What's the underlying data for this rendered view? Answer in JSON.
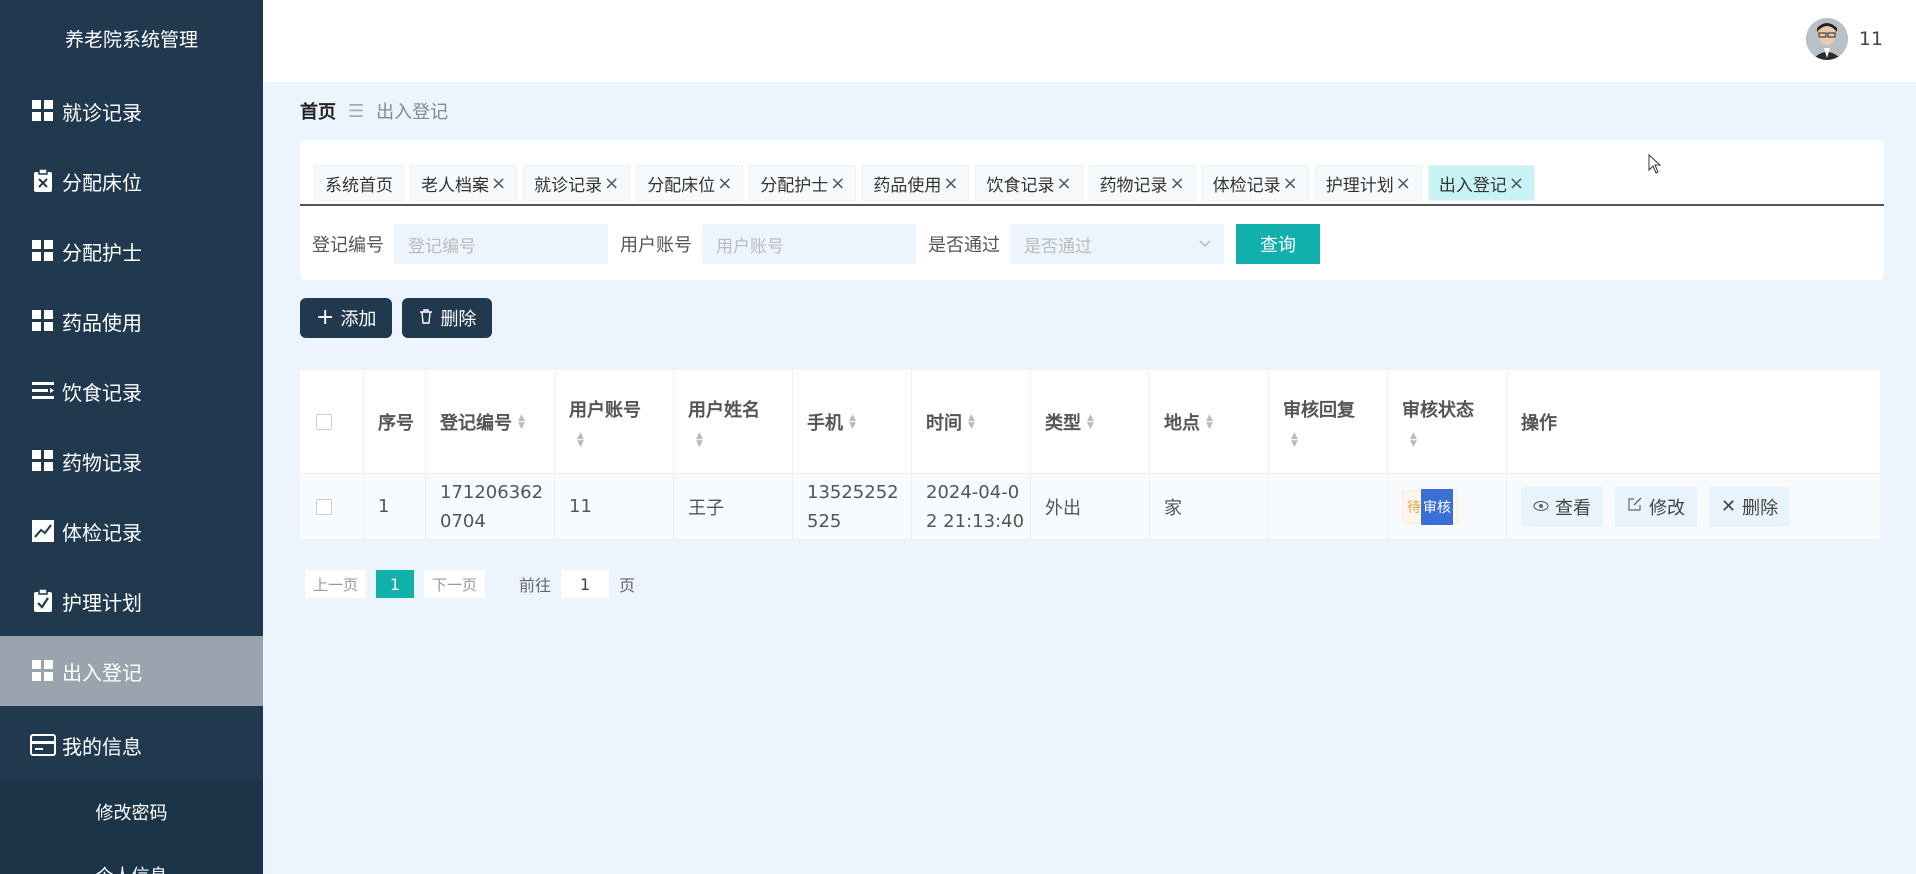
{
  "sidebar": {
    "brand": "养老院系统管理",
    "items": [
      {
        "label": "就诊记录",
        "icon": "grid-icon"
      },
      {
        "label": "分配床位",
        "icon": "clipboard-x-icon"
      },
      {
        "label": "分配护士",
        "icon": "grid-icon"
      },
      {
        "label": "药品使用",
        "icon": "grid-icon"
      },
      {
        "label": "饮食记录",
        "icon": "list-icon"
      },
      {
        "label": "药物记录",
        "icon": "grid-icon"
      },
      {
        "label": "体检记录",
        "icon": "chart-icon"
      },
      {
        "label": "护理计划",
        "icon": "clipboard-check-icon"
      },
      {
        "label": "出入登记",
        "icon": "grid-icon",
        "active": true
      },
      {
        "label": "我的信息",
        "icon": "card-icon"
      }
    ],
    "submenu": [
      "修改密码",
      "个人信息"
    ]
  },
  "topbar": {
    "username": "11"
  },
  "breadcrumb": {
    "home": "首页",
    "current": "出入登记"
  },
  "tabs": [
    {
      "label": "系统首页",
      "closable": false
    },
    {
      "label": "老人档案",
      "closable": true
    },
    {
      "label": "就诊记录",
      "closable": true
    },
    {
      "label": "分配床位",
      "closable": true
    },
    {
      "label": "分配护士",
      "closable": true
    },
    {
      "label": "药品使用",
      "closable": true
    },
    {
      "label": "饮食记录",
      "closable": true
    },
    {
      "label": "药物记录",
      "closable": true
    },
    {
      "label": "体检记录",
      "closable": true
    },
    {
      "label": "护理计划",
      "closable": true
    },
    {
      "label": "出入登记",
      "closable": true,
      "active": true
    }
  ],
  "search": {
    "f1_label": "登记编号",
    "f1_placeholder": "登记编号",
    "f2_label": "用户账号",
    "f2_placeholder": "用户账号",
    "f3_label": "是否通过",
    "f3_placeholder": "是否通过",
    "query": "查询"
  },
  "actions": {
    "add": "添加",
    "delete": "删除"
  },
  "table": {
    "headers": {
      "index": "序号",
      "code": "登记编号",
      "account": "用户账号",
      "name": "用户姓名",
      "phone": "手机",
      "time": "时间",
      "type": "类型",
      "place": "地点",
      "reply": "审核回复",
      "status": "审核状态",
      "ops": "操作"
    },
    "rows": [
      {
        "index": "1",
        "code_l1": "171206362",
        "code_l2": "0704",
        "account": "11",
        "name": "王子",
        "phone_l1": "13525252",
        "phone_l2": "525",
        "time_l1": "2024-04-0",
        "time_l2": "2 21:13:40",
        "type": "外出",
        "place": "家",
        "reply": "",
        "status_a": "待",
        "status_b": "审核"
      }
    ],
    "ops": {
      "view": "查看",
      "edit": "修改",
      "delete": "删除"
    }
  },
  "pager": {
    "prev": "上一页",
    "current": "1",
    "next": "下一页",
    "goto": "前往",
    "page_input": "1",
    "page_unit": "页"
  },
  "colors": {
    "sidebar": "#20394f",
    "accent": "#12b0ac",
    "bg": "#ecf5fd"
  }
}
